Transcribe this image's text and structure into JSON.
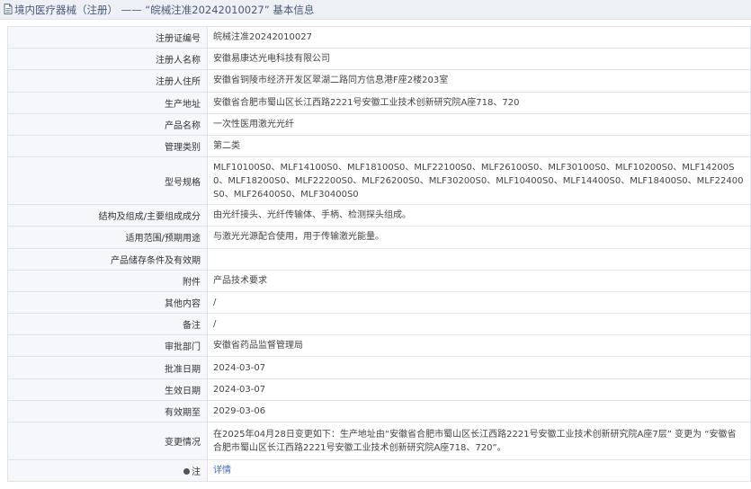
{
  "header": {
    "title": "境内医疗器械（注册） —— “皖械注准20242010027” 基本信息",
    "icon": "document-icon"
  },
  "rows": [
    {
      "label": "注册证编号",
      "value": "皖械注准20242010027"
    },
    {
      "label": "注册人名称",
      "value": "安徽易康达光电科技有限公司"
    },
    {
      "label": "注册人住所",
      "value": "安徽省铜陵市经济开发区翠湖二路同方信息港F座2楼203室"
    },
    {
      "label": "生产地址",
      "value": "安徽省合肥市蜀山区长江西路2221号安徽工业技术创新研究院A座718、720"
    },
    {
      "label": "产品名称",
      "value": "一次性医用激光光纤"
    },
    {
      "label": "管理类别",
      "value": "第二类"
    },
    {
      "label": "型号规格",
      "value": "MLF10100S0、MLF14100S0、MLF18100S0、MLF22100S0、MLF26100S0、MLF30100S0、MLF10200S0、MLF14200S0、MLF18200S0、MLF22200S0、MLF26200S0、MLF30200S0、MLF10400S0、MLF14400S0、MLF18400S0、MLF22400S0、MLF26400S0、MLF30400S0"
    },
    {
      "label": "结构及组成/主要组成成分",
      "value": "由光纤接头、光纤传输体、手柄、检测探头组成。"
    },
    {
      "label": "适用范围/预期用途",
      "value": "与激光光源配合使用，用于传输激光能量。"
    },
    {
      "label": "产品储存条件及有效期",
      "value": ""
    },
    {
      "label": "附件",
      "value": "产品技术要求"
    },
    {
      "label": "其他内容",
      "value": "/"
    },
    {
      "label": "备注",
      "value": "/"
    },
    {
      "label": "审批部门",
      "value": "安徽省药品监督管理局"
    },
    {
      "label": "批准日期",
      "value": "2024-03-07"
    },
    {
      "label": "生效日期",
      "value": "2024-03-07"
    },
    {
      "label": "有效期至",
      "value": "2029-03-06"
    },
    {
      "label": "变更情况",
      "value": "在2025年04月28日变更如下：生产地址由“安徽省合肥市蜀山区长江西路2221号安徽工业技术创新研究院A座7层” 变更为 “安徽省合肥市蜀山区长江西路2221号安徽工业技术创新研究院A座718、720”。"
    }
  ],
  "footer_row": {
    "label": "注",
    "link_text": "详情",
    "icon": "pin-icon"
  }
}
